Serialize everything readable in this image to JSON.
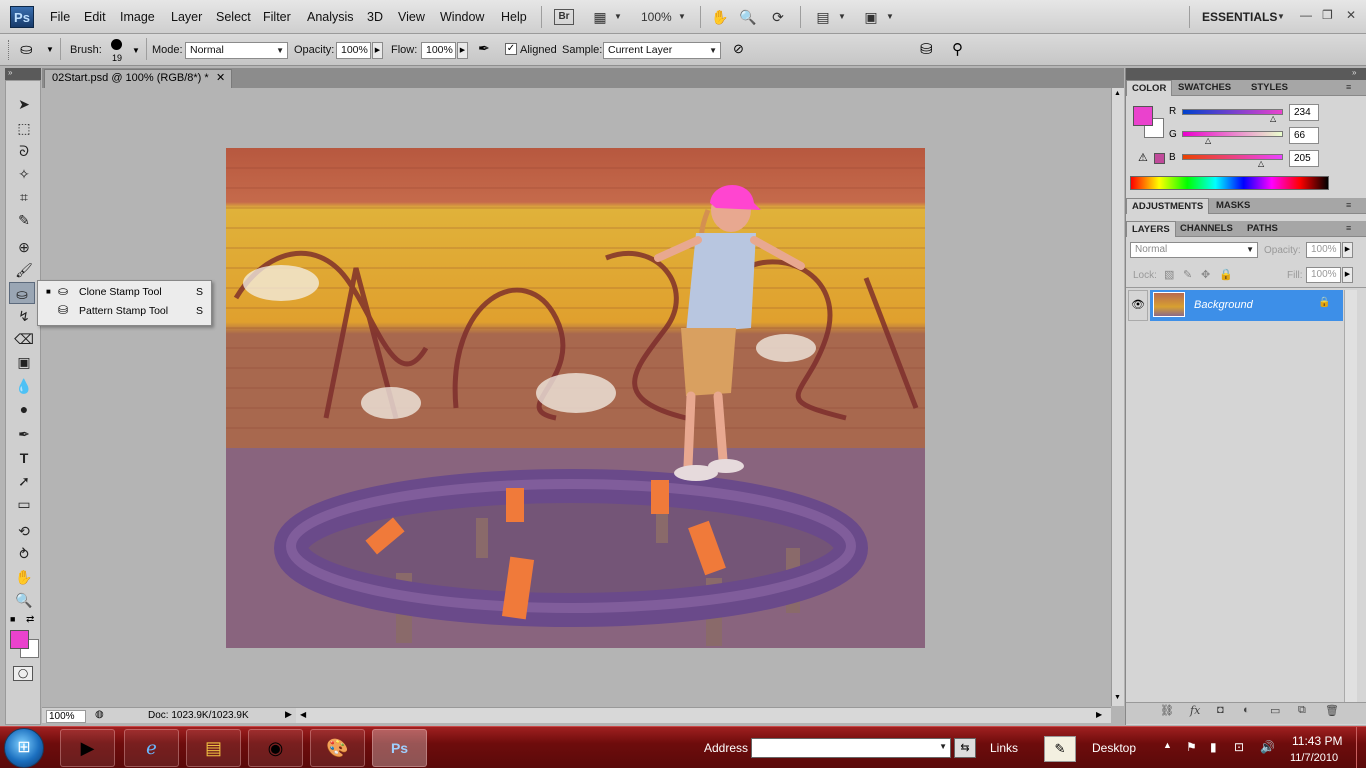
{
  "menubar": {
    "logo": "Ps",
    "items": [
      "File",
      "Edit",
      "Image",
      "Layer",
      "Select",
      "Filter",
      "Analysis",
      "3D",
      "View",
      "Window",
      "Help"
    ],
    "bridge": "Br",
    "zoom": "100%",
    "workspace": "ESSENTIALS"
  },
  "options": {
    "brush_label": "Brush:",
    "brush_size": "19",
    "mode_label": "Mode:",
    "mode_value": "Normal",
    "opacity_label": "Opacity:",
    "opacity_value": "100%",
    "flow_label": "Flow:",
    "flow_value": "100%",
    "aligned_label": "Aligned",
    "aligned_checked": true,
    "sample_label": "Sample:",
    "sample_value": "Current Layer"
  },
  "document": {
    "tab_title": "02Start.psd @ 100% (RGB/8*) *",
    "status_zoom": "100%",
    "status_doc": "Doc: 1023.9K/1023.9K"
  },
  "flyout": {
    "items": [
      {
        "label": "Clone Stamp Tool",
        "shortcut": "S",
        "selected": true
      },
      {
        "label": "Pattern Stamp Tool",
        "shortcut": "S",
        "selected": false
      }
    ]
  },
  "color_panel": {
    "tabs": [
      "COLOR",
      "SWATCHES",
      "STYLES"
    ],
    "r_label": "R",
    "g_label": "G",
    "b_label": "B",
    "r": 234,
    "g": 66,
    "b": 205,
    "foreground": "#ea42cd",
    "background": "#ffffff"
  },
  "adjust_panel": {
    "tabs": [
      "ADJUSTMENTS",
      "MASKS"
    ]
  },
  "layers_panel": {
    "tabs": [
      "LAYERS",
      "CHANNELS",
      "PATHS"
    ],
    "blend_mode": "Normal",
    "opacity_label": "Opacity:",
    "opacity_value": "100%",
    "lock_label": "Lock:",
    "fill_label": "Fill:",
    "fill_value": "100%",
    "layer_name": "Background"
  },
  "taskbar": {
    "address_label": "Address",
    "links_label": "Links",
    "desktop_label": "Desktop",
    "time": "11:43 PM",
    "date": "11/7/2010"
  }
}
